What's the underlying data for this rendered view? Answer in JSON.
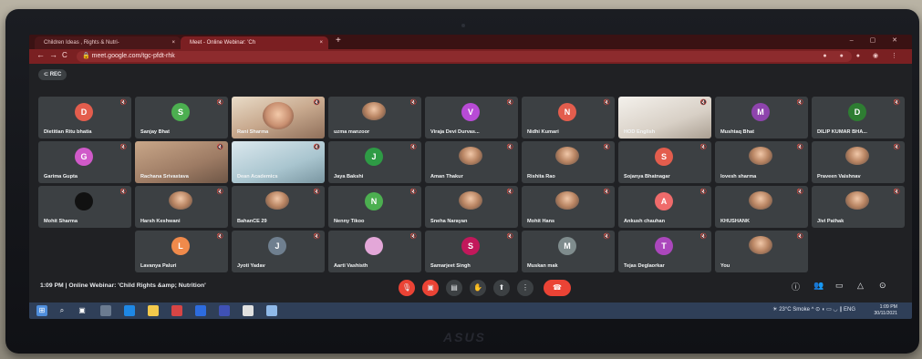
{
  "browser": {
    "tabs": [
      {
        "title": "Children Ideas , Rights & Nutri-",
        "close": "×"
      },
      {
        "title": "Meet - Online Webinar: 'Ch",
        "close": "×"
      }
    ],
    "new_tab": "+",
    "url": "meet.google.com/tgc-pfdt-rhk",
    "back": "←",
    "forward": "→",
    "reload": "C"
  },
  "meet": {
    "rec_label": "REC",
    "tiles": [
      {
        "name": "Dietitian Ritu bhatia",
        "initial": "D",
        "color": "#e35d4d"
      },
      {
        "name": "Sanjay Bhat",
        "initial": "S",
        "color": "#4caf50"
      },
      {
        "name": "Rani Sharma",
        "initial": "",
        "color": ""
      },
      {
        "name": "uzma manzoor",
        "initial": "",
        "color": ""
      },
      {
        "name": "Viraja Devi Durvas...",
        "initial": "V",
        "color": "#b84bd6"
      },
      {
        "name": "Nidhi Kumari",
        "initial": "N",
        "color": "#e35d4d"
      },
      {
        "name": "HOD English",
        "initial": "",
        "color": ""
      },
      {
        "name": "Mushtaq Bhat",
        "initial": "M",
        "color": "#8e44ad"
      },
      {
        "name": "DILIP KUMAR BHA...",
        "initial": "D",
        "color": "#2e7d32"
      },
      {
        "name": "Garima Gupta",
        "initial": "G",
        "color": "#d05ac9"
      },
      {
        "name": "Rachana Srivastava",
        "initial": "",
        "color": ""
      },
      {
        "name": "Dean Academics",
        "initial": "",
        "color": ""
      },
      {
        "name": "Jaya Bakshi",
        "initial": "J",
        "color": "#2e9b45"
      },
      {
        "name": "Aman Thakur",
        "initial": "",
        "color": ""
      },
      {
        "name": "Rishita Rao",
        "initial": "",
        "color": ""
      },
      {
        "name": "Sojanya Bhatnagar",
        "initial": "S",
        "color": "#e35d4d"
      },
      {
        "name": "lovesh sharma",
        "initial": "",
        "color": ""
      },
      {
        "name": "Praveen Vaishnav",
        "initial": "",
        "color": ""
      },
      {
        "name": "Mohit Sharma",
        "initial": "",
        "color": "#111111"
      },
      {
        "name": "Harsh Keshwani",
        "initial": "",
        "color": ""
      },
      {
        "name": "BahanCE 29",
        "initial": "",
        "color": ""
      },
      {
        "name": "Nenny Tikoo",
        "initial": "N",
        "color": "#4caf50"
      },
      {
        "name": "Sneha Narayan",
        "initial": "",
        "color": ""
      },
      {
        "name": "Mohit Hans",
        "initial": "",
        "color": ""
      },
      {
        "name": "Ankush chauhan",
        "initial": "A",
        "color": "#ef6b6b"
      },
      {
        "name": "KHUSHANK",
        "initial": "",
        "color": ""
      },
      {
        "name": "Jivi Pathak",
        "initial": "",
        "color": ""
      },
      {
        "name": "Lavanya Paluri",
        "initial": "L",
        "color": "#f08a4b"
      },
      {
        "name": "Jyoti Yadav",
        "initial": "J",
        "color": "#6f7f8f"
      },
      {
        "name": "Aarti Vashisth",
        "initial": "",
        "color": "#e3a7d8"
      },
      {
        "name": "Samarjeet Singh",
        "initial": "S",
        "color": "#c2185b"
      },
      {
        "name": "Muskan mak",
        "initial": "M",
        "color": "#7f8c8d"
      },
      {
        "name": "Tejas Deglaorkar",
        "initial": "T",
        "color": "#ab47bc"
      },
      {
        "name": "You",
        "initial": "",
        "color": ""
      }
    ],
    "meeting_info": "1:09 PM  |  Online Webinar: 'Child Rights &amp; Nutrition'",
    "controls": [
      "mic",
      "cam",
      "cc",
      "hand",
      "present",
      "more"
    ]
  },
  "taskbar": {
    "weather": "23°C Smoke",
    "lang": "ENG",
    "time": "1:09 PM",
    "date": "30/11/2021"
  },
  "laptop_brand": "ASUS"
}
